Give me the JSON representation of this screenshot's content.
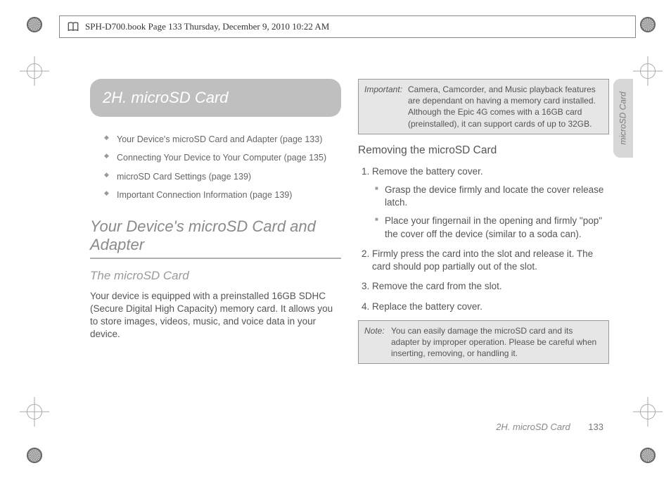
{
  "header": {
    "text": "SPH-D700.book  Page 133  Thursday, December 9, 2010  10:22 AM"
  },
  "chapter": {
    "number": "2H.",
    "title": "microSD Card"
  },
  "toc": [
    "Your Device's microSD Card and Adapter (page 133)",
    "Connecting Your Device to Your Computer (page 135)",
    "microSD Card Settings (page 139)",
    "Important Connection Information (page 139)"
  ],
  "left": {
    "h2": "Your Device's microSD Card and Adapter",
    "h3": "The microSD Card",
    "p1": "Your device is equipped with a preinstalled 16GB SDHC (Secure Digital High Capacity) memory card. It allows you to store images, videos, music, and voice data in your device."
  },
  "right": {
    "important": {
      "label": "Important:",
      "text": "Camera, Camcorder, and Music playback features are dependant on having a memory card installed. Although the Epic 4G comes with a 16GB card (preinstalled), it can support cards of up to 32GB."
    },
    "h3": "Removing the microSD Card",
    "steps": {
      "s1": "Remove the battery cover.",
      "s1a": "Grasp the device firmly and locate the cover release latch.",
      "s1b": "Place your fingernail in the opening and firmly \"pop\" the cover off the device (similar to a soda can).",
      "s2": "Firmly press the card into the slot and release it. The card should pop partially out of the slot.",
      "s3": "Remove the card from the slot.",
      "s4": "Replace the battery cover."
    },
    "note": {
      "label": "Note:",
      "text": "You can easily damage the microSD card and its adapter by improper operation. Please be careful when inserting, removing, or handling it."
    }
  },
  "sideTab": "microSD Card",
  "footer": {
    "label": "2H. microSD Card",
    "page": "133"
  }
}
